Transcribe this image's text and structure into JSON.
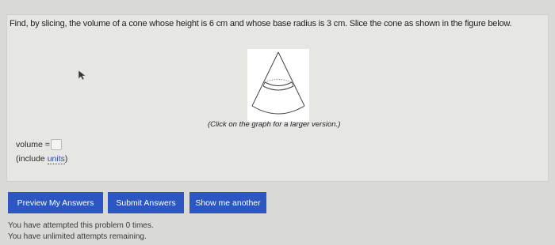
{
  "problem": {
    "text": "Find, by slicing, the volume of a cone whose height is 6 cm and whose base radius is 3 cm. Slice the cone as shown in the figure below.",
    "figure_caption": "(Click on the graph for a larger version.)"
  },
  "answer": {
    "volume_label": "volume =",
    "volume_value": "",
    "include_prefix": "(include ",
    "include_link": "units",
    "include_suffix": ")"
  },
  "buttons": {
    "preview": "Preview My Answers",
    "submit": "Submit Answers",
    "another": "Show me another"
  },
  "status": {
    "attempted": "You have attempted this problem 0 times.",
    "remaining": "You have unlimited attempts remaining."
  },
  "icons": {
    "cursor": "mouse-pointer-icon",
    "figure": "cone-slice-figure"
  },
  "colors": {
    "button": "#2c56c2",
    "link": "#2a4ea8",
    "panel": "#e6e6e3"
  }
}
